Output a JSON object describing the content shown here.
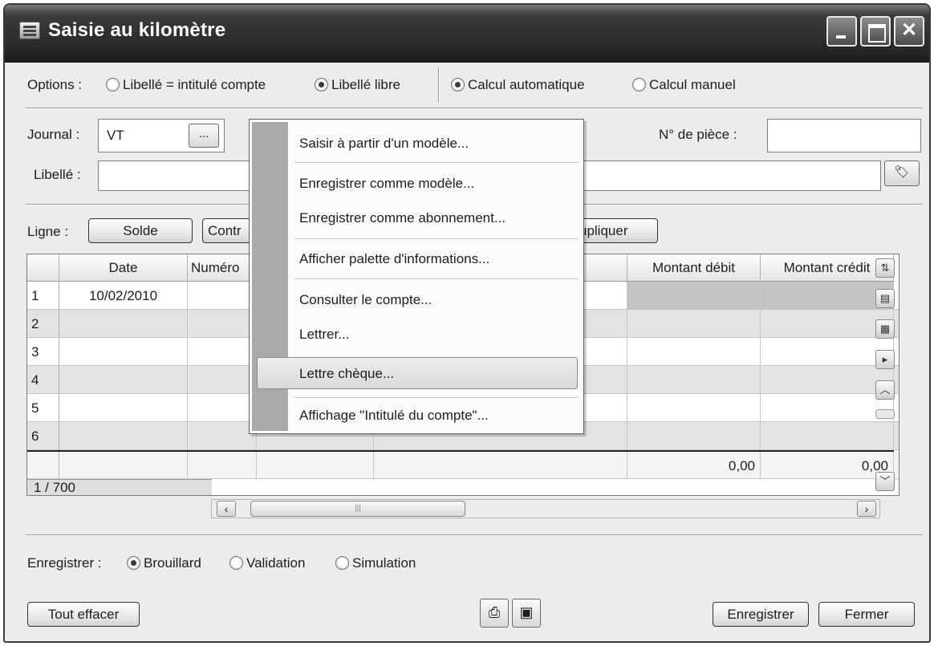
{
  "window": {
    "title": "Saisie au kilomètre"
  },
  "options": {
    "label": "Options :",
    "libelle_compte": "Libellé = intitulé compte",
    "libelle_libre": "Libellé libre",
    "calcul_auto": "Calcul automatique",
    "calcul_manuel": "Calcul manuel"
  },
  "journal": {
    "label": "Journal :",
    "value": "VT",
    "browse": "..."
  },
  "piece": {
    "label": "N° de pièce :",
    "value": ""
  },
  "libelle": {
    "label": "Libellé :",
    "value": ""
  },
  "ligne": {
    "label": "Ligne :",
    "solde": "Solde",
    "contr": "Contr",
    "dupliquer": "upliquer"
  },
  "grid": {
    "columns": [
      "Date",
      "Numéro",
      "Montant débit",
      "Montant crédit"
    ],
    "rows": [
      {
        "n": "1",
        "date": "10/02/2010"
      },
      {
        "n": "2",
        "date": ""
      },
      {
        "n": "3",
        "date": ""
      },
      {
        "n": "4",
        "date": ""
      },
      {
        "n": "5",
        "date": ""
      },
      {
        "n": "6",
        "date": ""
      }
    ],
    "total_debit": "0,00",
    "total_credit": "0,00",
    "position": "1 / 700"
  },
  "context_menu": {
    "items": [
      "Saisir à partir d'un modèle...",
      "Enregistrer comme modèle...",
      "Enregistrer comme abonnement...",
      "Afficher palette d'informations...",
      "Consulter le compte...",
      "Lettrer...",
      "Lettre chèque...",
      "Affichage \"Intitulé du compte\"..."
    ],
    "highlighted_index": 6
  },
  "enregistrer": {
    "label": "Enregistrer :",
    "brouillard": "Brouillard",
    "validation": "Validation",
    "simulation": "Simulation"
  },
  "footer": {
    "tout_effacer": "Tout effacer",
    "enregistrer": "Enregistrer",
    "fermer": "Fermer"
  }
}
